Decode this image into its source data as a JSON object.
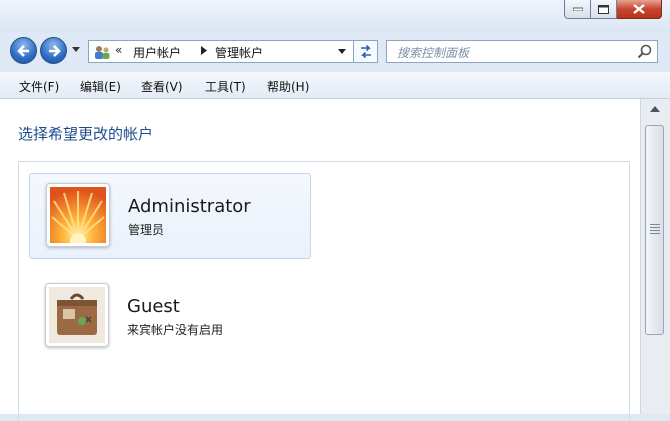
{
  "window": {
    "buttons": {
      "minimize": "minimize-icon",
      "maximize": "maximize-icon",
      "close": "close-icon"
    }
  },
  "nav": {
    "breadcrumb_prefix": "«",
    "breadcrumbs": [
      "用户帐户",
      "管理帐户"
    ],
    "search_placeholder": "搜索控制面板"
  },
  "menu": [
    "文件(F)",
    "编辑(E)",
    "查看(V)",
    "工具(T)",
    "帮助(H)"
  ],
  "content": {
    "heading": "选择希望更改的帐户",
    "accounts": [
      {
        "name": "Administrator",
        "role": "管理员",
        "picture": "flower-avatar-icon",
        "selected": true
      },
      {
        "name": "Guest",
        "role": "来宾帐户没有启用",
        "picture": "suitcase-avatar-icon",
        "selected": false
      }
    ]
  },
  "colors": {
    "heading": "#1e4c8f",
    "close_button": "#c7452f",
    "nav_button": "#2d6cc2",
    "selected_row": "#e9f1fb"
  }
}
